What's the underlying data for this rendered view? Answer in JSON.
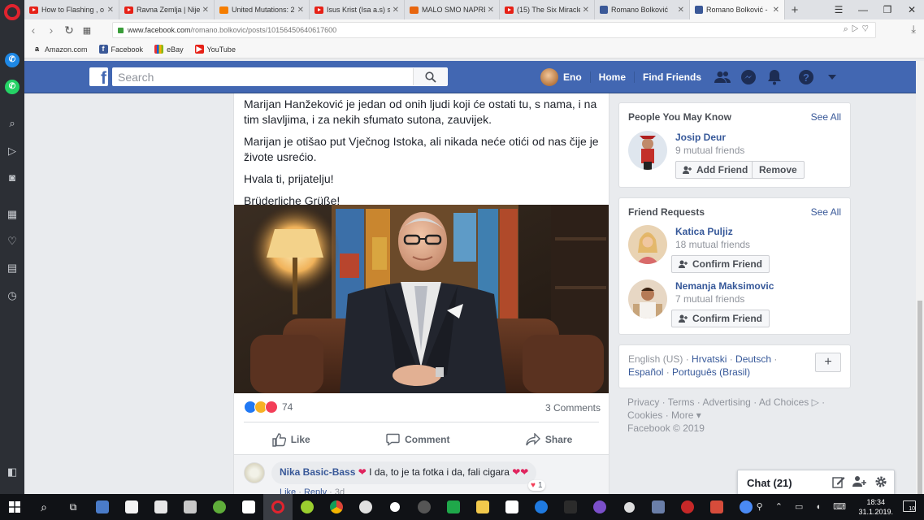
{
  "browser": {
    "tabs": [
      {
        "title": "How to Flashing , o",
        "icon": "youtube-icon",
        "active": false
      },
      {
        "title": "Ravna Zemlja | Nije",
        "icon": "youtube-icon",
        "active": false
      },
      {
        "title": "United Mutations: 2",
        "icon": "blogger-icon",
        "active": false
      },
      {
        "title": "Isus Krist (Isa a.s) s",
        "icon": "youtube-icon",
        "active": false
      },
      {
        "title": "MALO SMO NAPRE",
        "icon": "orange-page-icon",
        "active": false
      },
      {
        "title": "(15) The Six Miracle",
        "icon": "youtube-icon",
        "active": false
      },
      {
        "title": "Romano Bolković",
        "icon": "facebook-icon",
        "active": false
      },
      {
        "title": "Romano Bolković -",
        "icon": "facebook-icon",
        "active": true
      }
    ],
    "url_host": "www.facebook.com",
    "url_path": "/romano.bolkovic/posts/10156450640617600",
    "bookmarks": [
      {
        "label": "Amazon.com",
        "icon": "amazon-icon"
      },
      {
        "label": "Facebook",
        "icon": "facebook-icon"
      },
      {
        "label": "eBay",
        "icon": "ebay-icon"
      },
      {
        "label": "YouTube",
        "icon": "youtube-icon"
      }
    ]
  },
  "fb_header": {
    "search_placeholder": "Search",
    "user_name": "Eno",
    "home_label": "Home",
    "find_friends_label": "Find Friends"
  },
  "post": {
    "paragraphs": [
      "Marijan Hanžeković je jedan od onih ljudi koji će ostati tu, s nama, i na tim slavljima, i za nekih sfumato sutona, zauvijek.",
      "Marijan je otišao put Vječnog Istoka, ali nikada neće otići od nas čije je živote usrećio.",
      "Hvala ti, prijatelju!",
      "Brüderliche Grüße!"
    ],
    "reaction_count": "74",
    "comments_label": "3 Comments",
    "like_label": "Like",
    "comment_label": "Comment",
    "share_label": "Share",
    "comment": {
      "author": "Nika Basic-Bass",
      "text": "I da, to je ta fotka i da, fali cigara",
      "like_link": "Like",
      "reply_link": "Reply",
      "age": "3d",
      "reaction_count": "1"
    }
  },
  "people_you_may_know": {
    "title": "People You May Know",
    "see_all": "See All",
    "person": {
      "name": "Josip Deur",
      "mutual": "9 mutual friends",
      "add_label": "Add Friend",
      "remove_label": "Remove"
    }
  },
  "friend_requests": {
    "title": "Friend Requests",
    "see_all": "See All",
    "people": [
      {
        "name": "Katica Puljiz",
        "mutual": "18 mutual friends",
        "confirm_label": "Confirm Friend"
      },
      {
        "name": "Nemanja Maksimovic",
        "mutual": "7 mutual friends",
        "confirm_label": "Confirm Friend"
      }
    ]
  },
  "languages": {
    "current": "English (US)",
    "links": [
      "Hrvatski",
      "Deutsch",
      "Español",
      "Português (Brasil)"
    ],
    "add_label": "+"
  },
  "footer": {
    "links": [
      "Privacy",
      "Terms",
      "Advertising",
      "Ad Choices",
      "Cookies",
      "More"
    ],
    "copyright": "Facebook © 2019"
  },
  "chat": {
    "label": "Chat (21)"
  },
  "taskbar": {
    "time": "18:34",
    "date": "31.1.2019.",
    "notification_count": "10"
  },
  "colors": {
    "fb_blue": "#4267b2",
    "link_blue": "#365899",
    "opera_red": "#e0232e"
  }
}
